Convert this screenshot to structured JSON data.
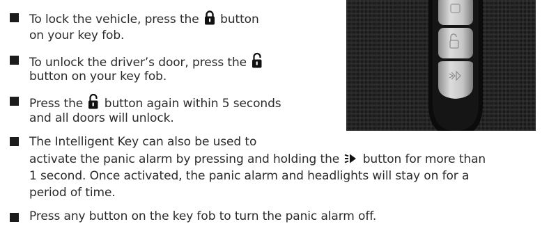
{
  "bullets": [
    {
      "lines": [
        [
          "To lock the vehicle, press the ",
          "lock-icon",
          " button"
        ],
        [
          "on your key fob."
        ]
      ]
    },
    {
      "lines": [
        [
          "To unlock the driver’s door, press the ",
          "unlock-icon"
        ],
        [
          "button on your key fob."
        ]
      ]
    },
    {
      "lines": [
        [
          "Press the ",
          "unlock-icon",
          " button again within 5 seconds"
        ],
        [
          "and all doors will unlock."
        ]
      ]
    },
    {
      "lines": [
        [
          "The Intelligent Key can also be used to"
        ],
        [
          "activate the panic alarm by pressing and holding the ",
          "panic-alarm-icon",
          " button for more than"
        ],
        [
          "1 second. Once activated, the panic alarm and headlights will stay on for a"
        ],
        [
          "period of time."
        ]
      ]
    },
    {
      "lines": [
        [
          "Press any button on the key fob to turn the panic alarm off."
        ]
      ]
    }
  ],
  "photo": {
    "subject": "key-fob-photo",
    "buttons": [
      "lock-icon",
      "unlock-icon",
      "panic-alarm-icon"
    ]
  },
  "colors": {
    "text": "#2a2a2a",
    "bullet": "#1c1c1c",
    "fob_body": "#0e0e0e",
    "fob_button": "#c9c9c9",
    "surface": "#262626"
  }
}
